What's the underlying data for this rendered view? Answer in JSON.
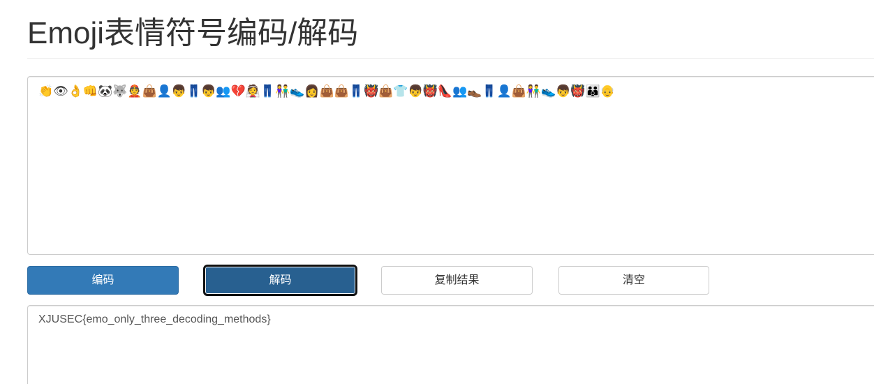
{
  "page": {
    "title": "Emoji表情符号编码/解码"
  },
  "input": {
    "value": "👏👁👌👊🐼🐺👲👜👤👦👖👦👥💔👰👖👫👟👩👜👜👖👹👜👕👦👹👠👥👞👖👤👜👫👟👦👹👪👴"
  },
  "buttons": {
    "encode_label": "编码",
    "decode_label": "解码",
    "copy_label": "复制结果",
    "clear_label": "清空"
  },
  "output": {
    "value": "XJUSEC{emo_only_three_decoding_methods}"
  },
  "colors": {
    "primary": "#337ab7",
    "primary_active": "#286090",
    "border": "#cccccc"
  }
}
